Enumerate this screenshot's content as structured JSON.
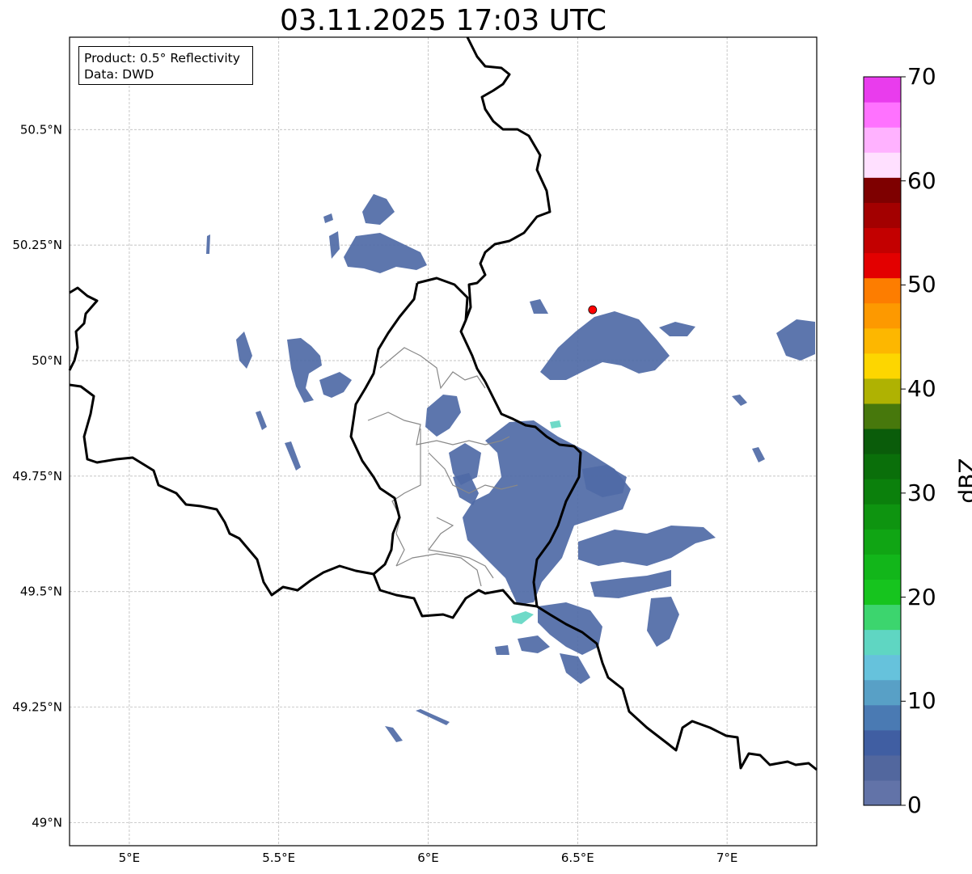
{
  "title": "03.11.2025 17:03 UTC",
  "info_box": {
    "line1": "Product: 0.5° Reflectivity",
    "line2": "Data: DWD"
  },
  "map": {
    "lon_range": [
      4.8,
      7.3
    ],
    "lat_range": [
      48.95,
      50.7
    ],
    "lon_ticks": [
      {
        "value": 5.0,
        "label": "5°E"
      },
      {
        "value": 5.5,
        "label": "5.5°E"
      },
      {
        "value": 6.0,
        "label": "6°E"
      },
      {
        "value": 6.5,
        "label": "6.5°E"
      },
      {
        "value": 7.0,
        "label": "7°E"
      }
    ],
    "lat_ticks": [
      {
        "value": 49.0,
        "label": "49°N"
      },
      {
        "value": 49.25,
        "label": "49.25°N"
      },
      {
        "value": 49.5,
        "label": "49.5°N"
      },
      {
        "value": 49.75,
        "label": "49.75°N"
      },
      {
        "value": 50.0,
        "label": "50°N"
      },
      {
        "value": 50.25,
        "label": "50.25°N"
      },
      {
        "value": 50.5,
        "label": "50.5°N"
      }
    ],
    "gridlines": true,
    "radar_site": {
      "lon": 6.55,
      "lat": 50.11,
      "color": "#ff0000"
    },
    "colors": {
      "border": "#000000",
      "admin": "#888888",
      "echo_main": "#4f6aa6",
      "echo_light": "#5b86b8"
    }
  },
  "colorbar": {
    "unit": "dBZ",
    "min": 0,
    "max": 70,
    "ticks": [
      {
        "value": 0,
        "label": "0"
      },
      {
        "value": 10,
        "label": "10"
      },
      {
        "value": 20,
        "label": "20"
      },
      {
        "value": 30,
        "label": "30"
      },
      {
        "value": 40,
        "label": "40"
      },
      {
        "value": 50,
        "label": "50"
      },
      {
        "value": 60,
        "label": "60"
      },
      {
        "value": 70,
        "label": "70"
      }
    ],
    "colors": [
      "#6273a8",
      "#52679e",
      "#405ea2",
      "#4a7ab3",
      "#58a0c6",
      "#66c2dc",
      "#5fd6c2",
      "#3cd56e",
      "#16c41e",
      "#12b61a",
      "#10a514",
      "#0e9410",
      "#0b800c",
      "#0a6f0a",
      "#0a5c0a",
      "#47780c",
      "#afb202",
      "#fdd600",
      "#fdb700",
      "#fd9900",
      "#fd7d00",
      "#e30000",
      "#c30000",
      "#a30000",
      "#7e0000",
      "#ffe0ff",
      "#ffb2ff",
      "#ff72ff",
      "#e93ced"
    ]
  }
}
